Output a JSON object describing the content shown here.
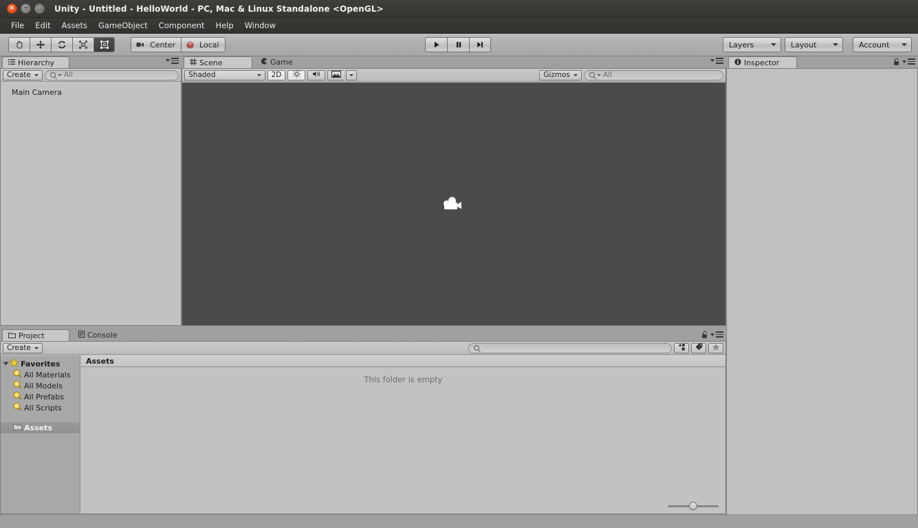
{
  "window": {
    "title": "Unity - Untitled - HelloWorld - PC, Mac & Linux Standalone <OpenGL>",
    "close_glyph": "×",
    "minimize_glyph": "−",
    "maximize_glyph": "□"
  },
  "menu": {
    "items": [
      {
        "label": "File"
      },
      {
        "label": "Edit"
      },
      {
        "label": "Assets"
      },
      {
        "label": "GameObject"
      },
      {
        "label": "Component"
      },
      {
        "label": "Help"
      },
      {
        "label": "Window"
      }
    ]
  },
  "toolbar": {
    "tools": [
      {
        "name": "hand-tool",
        "selected": false
      },
      {
        "name": "move-tool",
        "selected": false
      },
      {
        "name": "rotate-tool",
        "selected": false
      },
      {
        "name": "scale-tool",
        "selected": false
      },
      {
        "name": "rect-tool",
        "selected": true
      }
    ],
    "pivot_label": "Center",
    "rotation_label": "Local",
    "play_label": "Play",
    "pause_label": "Pause",
    "step_label": "Step",
    "layers_label": "Layers",
    "layout_label": "Layout",
    "account_label": "Account"
  },
  "hierarchy": {
    "tab_label": "Hierarchy",
    "create_label": "Create",
    "search_placeholder": "All",
    "items": [
      {
        "label": "Main Camera"
      }
    ]
  },
  "scene": {
    "tab_label": "Scene",
    "game_tab_label": "Game",
    "shading_mode": "Shaded",
    "mode_2d_label": "2D",
    "lighting_name": "lighting-toggle",
    "audio_name": "audio-toggle",
    "effects_name": "effects-toggle",
    "gizmos_label": "Gizmos",
    "search_placeholder": "All",
    "camera_gizmo_name": "main-camera-gizmo",
    "background_color": "#4b4b4b"
  },
  "inspector": {
    "tab_label": "Inspector"
  },
  "project": {
    "tab_label": "Project",
    "console_tab_label": "Console",
    "create_label": "Create",
    "search_placeholder": "",
    "favorites_label": "Favorites",
    "favorites": [
      {
        "label": "All Materials"
      },
      {
        "label": "All Models"
      },
      {
        "label": "All Prefabs"
      },
      {
        "label": "All Scripts"
      }
    ],
    "assets_label": "Assets",
    "breadcrumb": "Assets",
    "empty_message": "This folder is empty",
    "zoom_value": 50
  }
}
